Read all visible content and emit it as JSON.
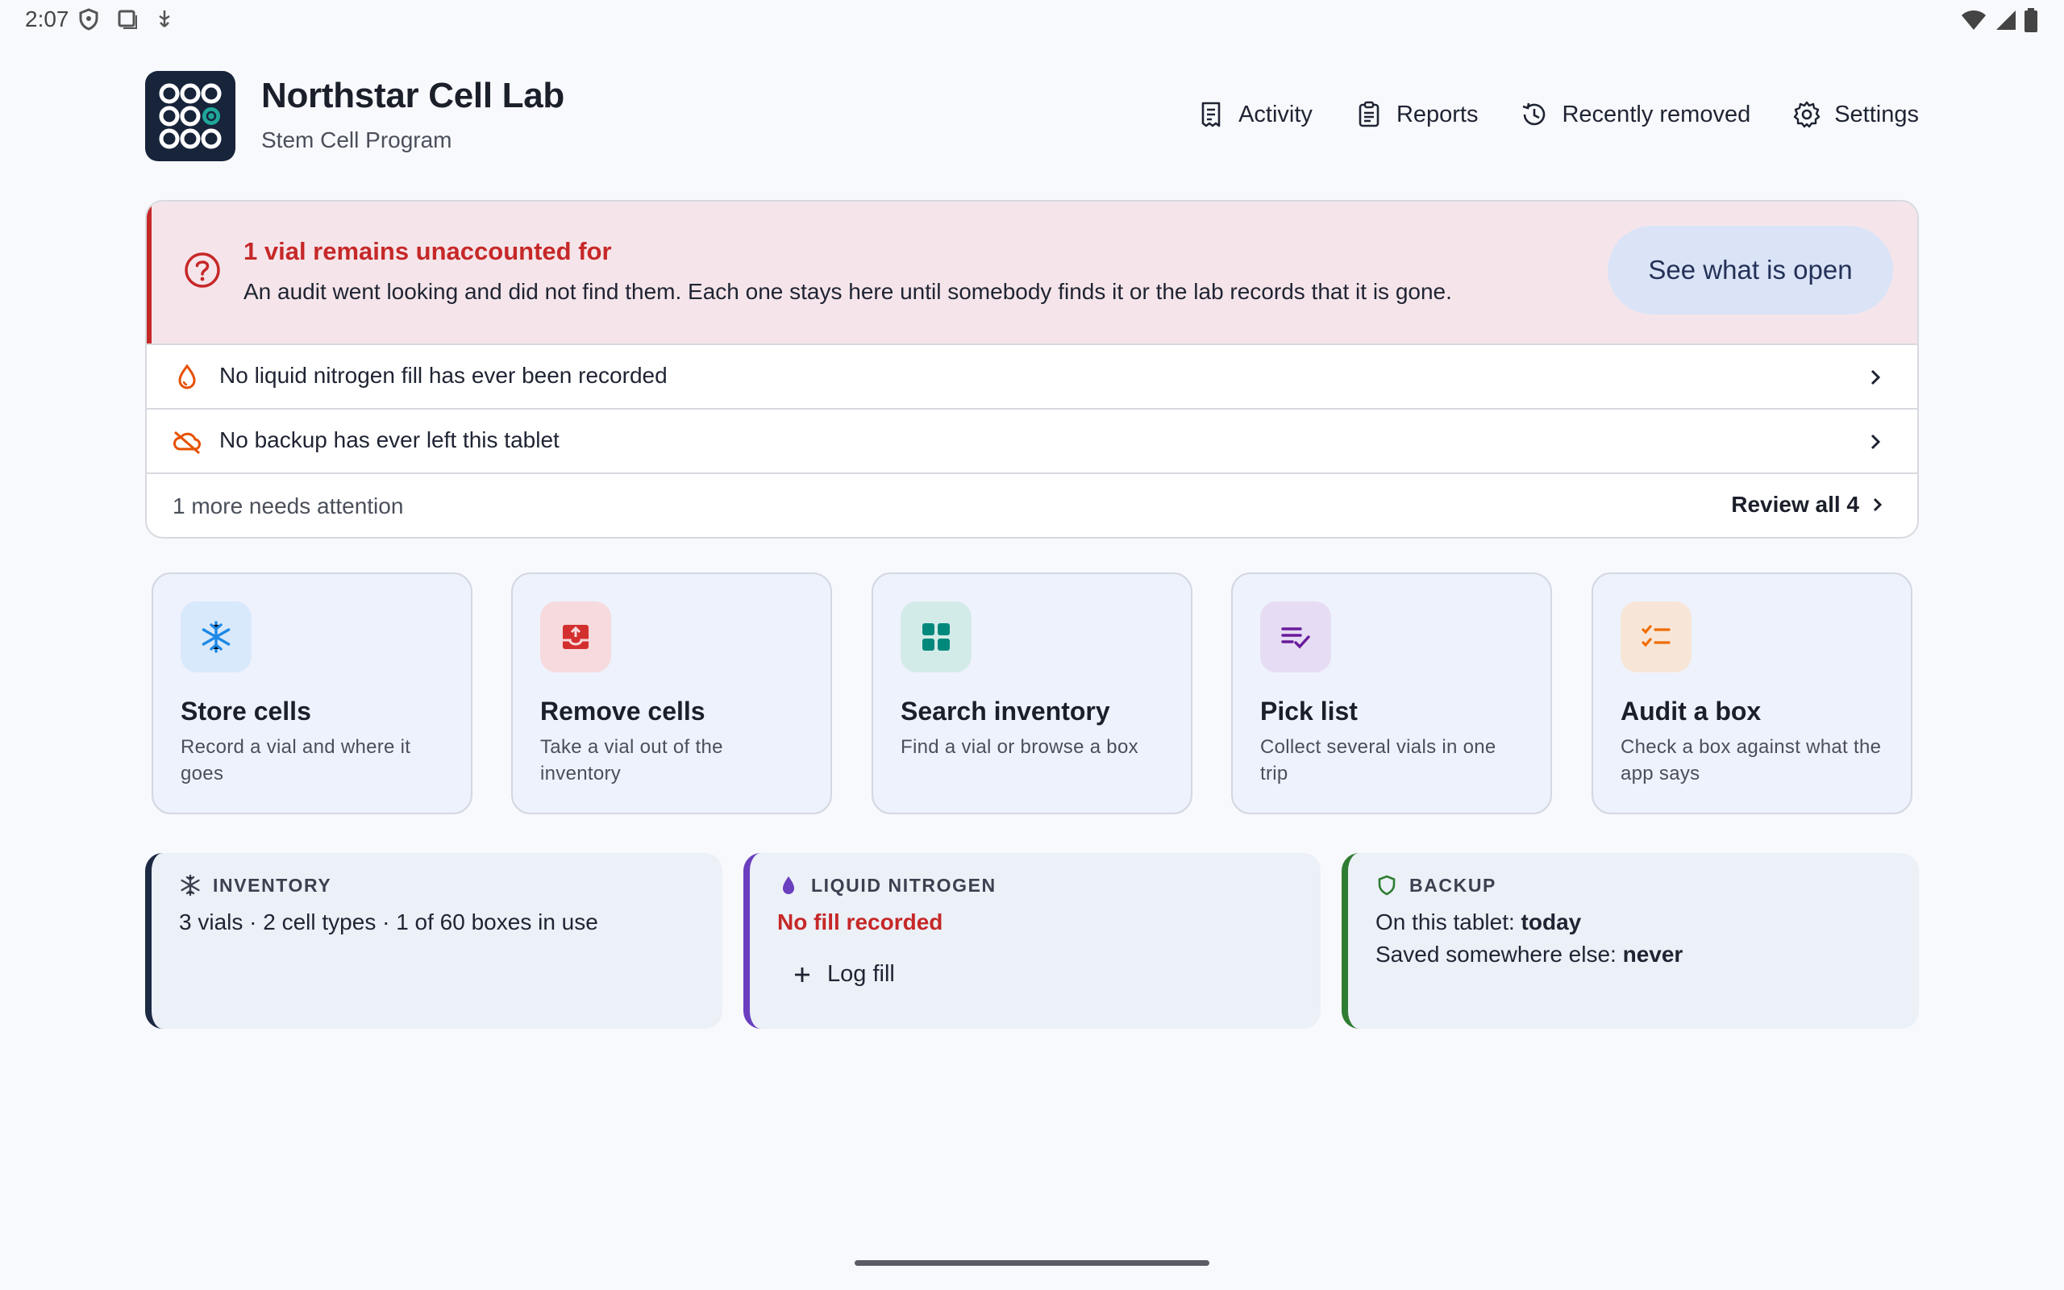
{
  "status_bar": {
    "time": "2:07",
    "left_icons": [
      "shield-icon",
      "screenshot-icon",
      "usb-debug-icon"
    ],
    "right_icons": [
      "wifi-icon",
      "signal-icon",
      "battery-icon"
    ]
  },
  "header": {
    "title": "Northstar Cell Lab",
    "subtitle": "Stem Cell Program",
    "nav": [
      {
        "label": "Activity",
        "icon": "receipt-icon"
      },
      {
        "label": "Reports",
        "icon": "clipboard-icon"
      },
      {
        "label": "Recently removed",
        "icon": "history-icon"
      },
      {
        "label": "Settings",
        "icon": "gear-icon"
      }
    ]
  },
  "alert": {
    "title": "1 vial remains unaccounted for",
    "description": "An audit went looking and did not find them. Each one stays here until somebody finds it or the lab records that it is gone.",
    "button": "See what is open",
    "warnings": [
      {
        "label": "No liquid nitrogen fill has ever been recorded",
        "icon": "droplet-icon"
      },
      {
        "label": "No backup has ever left this tablet",
        "icon": "cloud-off-icon"
      }
    ],
    "more": "1 more needs attention",
    "review_all": "Review all 4"
  },
  "tiles": [
    {
      "title": "Store cells",
      "desc": "Record a vial and where it goes",
      "icon": "snowflake-icon",
      "bg": "#d8e9fb",
      "color": "#1e88e5"
    },
    {
      "title": "Remove cells",
      "desc": "Take a vial out of the inventory",
      "icon": "unbox-icon",
      "bg": "#f6dadd",
      "color": "#d32f2f"
    },
    {
      "title": "Search inventory",
      "desc": "Find a vial or browse a box",
      "icon": "grid-icon",
      "bg": "#d3ebe8",
      "color": "#00897b"
    },
    {
      "title": "Pick list",
      "desc": "Collect several vials in one trip",
      "icon": "checklist-icon",
      "bg": "#e6dcf3",
      "color": "#6a1b9a"
    },
    {
      "title": "Audit a box",
      "desc": "Check a box against what the app says",
      "icon": "audit-list-icon",
      "bg": "#f7e6d8",
      "color": "#ef6c00"
    }
  ],
  "cards": {
    "inventory": {
      "label": "INVENTORY",
      "summary": "3 vials · 2 cell types · 1 of 60 boxes in use",
      "accent": "#1d2a44"
    },
    "nitrogen": {
      "label": "LIQUID NITROGEN",
      "status": "No fill recorded",
      "action": "Log fill",
      "accent": "#6a3fbf"
    },
    "backup": {
      "label": "BACKUP",
      "local_prefix": "On this tablet: ",
      "local_value": "today",
      "remote_prefix": "Saved somewhere else: ",
      "remote_value": "never",
      "accent": "#2e7d32"
    }
  }
}
